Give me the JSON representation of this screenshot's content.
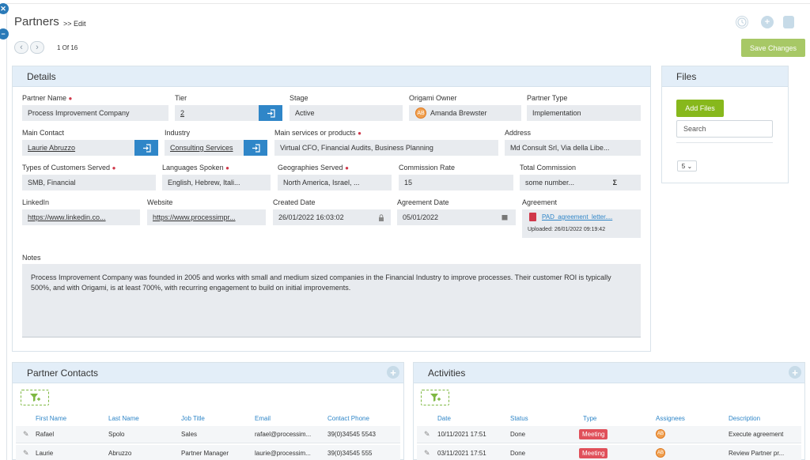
{
  "header": {
    "title": "Partners",
    "breadcrumb": ">> Edit",
    "record_counter": "1 Of 16",
    "save_label": "Save Changes",
    "side_icons": [
      "close-icon",
      "minus-icon"
    ],
    "toolbar_icons": [
      "history-icon",
      "add-icon",
      "more-icon"
    ]
  },
  "details": {
    "title": "Details",
    "fields": {
      "partner_name": {
        "label": "Partner Name",
        "value": "Process Improvement Company"
      },
      "tier": {
        "label": "Tier",
        "value": "2"
      },
      "stage": {
        "label": "Stage",
        "value": "Active"
      },
      "origami_owner": {
        "label": "Origami Owner",
        "value": "Amanda Brewster",
        "initials": "AB"
      },
      "partner_type": {
        "label": "Partner Type",
        "value": "Implementation"
      },
      "main_contact": {
        "label": "Main Contact",
        "value": "Laurie Abruzzo"
      },
      "industry": {
        "label": "Industry",
        "value": "Consulting Services"
      },
      "main_services": {
        "label": "Main services or products",
        "value": "Virtual CFO, Financial Audits, Business Planning"
      },
      "address": {
        "label": "Address",
        "value": "Md Consult Srl, Via della Libe..."
      },
      "types_of_customers": {
        "label": "Types of Customers Served",
        "value": "SMB, Financial"
      },
      "languages": {
        "label": "Languages Spoken",
        "value": "English, Hebrew, Itali..."
      },
      "geographies": {
        "label": "Geographies Served",
        "value": "North America, Israel, ..."
      },
      "commission_rate": {
        "label": "Commission Rate",
        "value": "15"
      },
      "total_commission": {
        "label": "Total Commission",
        "value": "some number...",
        "symbol": "Σ"
      },
      "linkedin": {
        "label": "LinkedIn",
        "value": "https://www.linkedin.co..."
      },
      "website": {
        "label": "Website",
        "value": "https://www.processimpr..."
      },
      "created_date": {
        "label": "Created Date",
        "value": "26/01/2022 16:03:02"
      },
      "agreement_date": {
        "label": "Agreement Date",
        "value": "05/01/2022"
      },
      "agreement": {
        "label": "Agreement",
        "file": "PAD_agreement_letter....",
        "uploaded": "Uploaded: 26/01/2022 09:19:42"
      }
    },
    "notes": {
      "label": "Notes",
      "text": "Process Improvement Company was founded in 2005 and works with small and medium sized companies in the Financial Industry to improve processes. Their customer ROI is typically 500%, and with Origami, is at least 700%,  with recurring engagement to build on initial improvements."
    }
  },
  "files": {
    "title": "Files",
    "add_label": "Add Files",
    "search_placeholder": "Search",
    "page_size": "5"
  },
  "contacts": {
    "title": "Partner Contacts",
    "columns": [
      "First Name",
      "Last Name",
      "Job Title",
      "Email",
      "Contact Phone"
    ],
    "rows": [
      [
        "Rafael",
        "Spolo",
        "Sales",
        "rafael@processim...",
        "39(0)34545 5543"
      ],
      [
        "Laurie",
        "Abruzzo",
        "Partner Manager",
        "laurie@processim...",
        "39(0)34545 555"
      ]
    ]
  },
  "activities": {
    "title": "Activities",
    "columns": [
      "Date",
      "Status",
      "Type",
      "Assignees",
      "Description"
    ],
    "rows": [
      [
        "10/11/2021 17:51",
        "Done",
        "Meeting",
        "AB",
        "Execute agreement"
      ],
      [
        "03/11/2021 17:51",
        "Done",
        "Meeting",
        "AB",
        "Review Partner pr..."
      ]
    ]
  },
  "colors": {
    "accent": "#2f86c8",
    "save": "#a7c866",
    "add_files": "#87b81c",
    "meeting": "#e0505a",
    "panel_header": "#e3eef8",
    "field_bg": "#e8ebef"
  }
}
